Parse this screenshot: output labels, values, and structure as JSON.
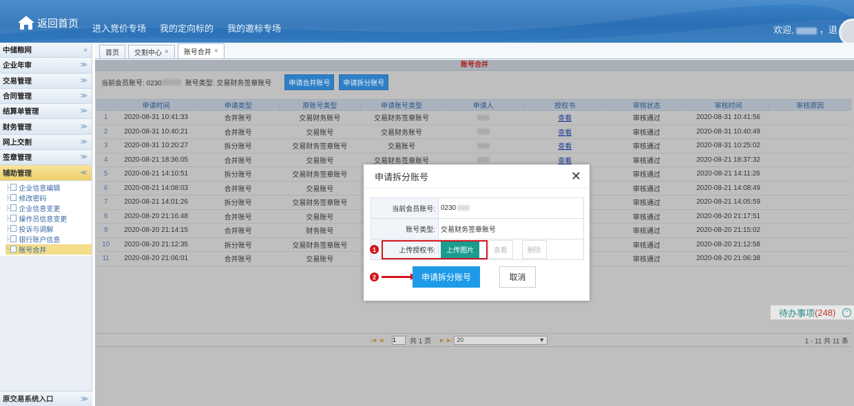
{
  "header": {
    "home_label": "返回首页",
    "nav": [
      "进入竞价专场",
      "我的定向标的",
      "我的邀标专场"
    ],
    "welcome_prefix": "欢迎,",
    "welcome_suffix": "，退"
  },
  "sidebar": {
    "items": [
      {
        "label": "中储粮网",
        "chev": "«"
      },
      {
        "label": "企业年审",
        "chev": "≫"
      },
      {
        "label": "交易管理",
        "chev": "≫"
      },
      {
        "label": "合同管理",
        "chev": "≫"
      },
      {
        "label": "结算单管理",
        "chev": "≫"
      },
      {
        "label": "财务管理",
        "chev": "≫"
      },
      {
        "label": "网上交割",
        "chev": "≫"
      },
      {
        "label": "签章管理",
        "chev": "≫"
      },
      {
        "label": "辅助管理",
        "chev": "≪"
      }
    ],
    "sub_items": [
      "企业信息编辑",
      "修改密码",
      "企业信息变更",
      "操作员信息变更",
      "投诉与调解",
      "银行账户信息",
      "账号合并"
    ],
    "bottom_label": "原交易系统入口",
    "bottom_chev": "≫"
  },
  "tabs": [
    {
      "label": "首页",
      "closable": false
    },
    {
      "label": "交割中心",
      "closable": true
    },
    {
      "label": "账号合并",
      "closable": true
    }
  ],
  "panel_title": "账号合并",
  "toolbar": {
    "member_label": "当前会员账号: 0230",
    "type_label": "账号类型: 交易财务签章账号",
    "merge_button": "申请合并账号",
    "split_button": "申请拆分账号"
  },
  "table": {
    "headers": [
      "申请时间",
      "申请类型",
      "原账号类型",
      "申请账号类型",
      "申请人",
      "授权书",
      "审核状态",
      "审核时间",
      "审核原因"
    ],
    "rows": [
      [
        "1",
        "2020-08-31 10:41:33",
        "合并账号",
        "交易财务账号",
        "交易财务签章账号",
        "",
        "查看",
        "审核通过",
        "2020-08-31 10:41:56",
        ""
      ],
      [
        "2",
        "2020-08-31 10:40:21",
        "合并账号",
        "交易账号",
        "交易财务账号",
        "",
        "查看",
        "审核通过",
        "2020-08-31 10:40:49",
        ""
      ],
      [
        "3",
        "2020-08-31 10:20:27",
        "拆分账号",
        "交易财务签章账号",
        "交易账号",
        "",
        "查看",
        "审核通过",
        "2020-08-31 10:25:02",
        ""
      ],
      [
        "4",
        "2020-08-21 18:36:05",
        "合并账号",
        "交易账号",
        "交易财务签章账号",
        "",
        "查看",
        "审核通过",
        "2020-08-21 18:37:32",
        ""
      ],
      [
        "5",
        "2020-08-21 14:10:51",
        "拆分账号",
        "交易财务签章账号",
        "",
        "",
        "",
        "审核通过",
        "2020-08-21 14:11:26",
        ""
      ],
      [
        "6",
        "2020-08-21 14:08:03",
        "合并账号",
        "交易账号",
        "",
        "",
        "",
        "审核通过",
        "2020-08-21 14:08:49",
        ""
      ],
      [
        "7",
        "2020-08-21 14:01:26",
        "拆分账号",
        "交易财务签章账号",
        "",
        "",
        "",
        "审核通过",
        "2020-08-21 14:05:59",
        ""
      ],
      [
        "8",
        "2020-08-20 21:16:48",
        "合并账号",
        "交易账号",
        "",
        "",
        "",
        "审核通过",
        "2020-08-20 21:17:51",
        ""
      ],
      [
        "9",
        "2020-08-20 21:14:15",
        "合并账号",
        "财务账号",
        "",
        "",
        "",
        "审核通过",
        "2020-08-20 21:15:02",
        ""
      ],
      [
        "10",
        "2020-08-20 21:12:35",
        "拆分账号",
        "交易财务签章账号",
        "",
        "",
        "",
        "审核通过",
        "2020-08-20 21:12:58",
        ""
      ],
      [
        "11",
        "2020-08-20 21:06:01",
        "合并账号",
        "交易账号",
        "",
        "",
        "",
        "审核通过",
        "2020-08-20 21:06:38",
        ""
      ]
    ]
  },
  "todo": {
    "label": "待办事项",
    "count": "(248)"
  },
  "pager": {
    "page_input": "1",
    "total_pages": "共 1 页",
    "page_size": "20",
    "info": "1 - 11  共 11 条"
  },
  "modal": {
    "title": "申请拆分账号",
    "member_label": "当前会员账号:",
    "member_value": "0230",
    "type_label": "账号类型:",
    "type_value": "交易财务签章账号",
    "upload_label": "上传授权书:",
    "upload_button": "上传图片",
    "view_button": "查看",
    "delete_button": "删除",
    "submit_button": "申请拆分账号",
    "cancel_button": "取消",
    "badge1": "1",
    "badge2": "2"
  }
}
